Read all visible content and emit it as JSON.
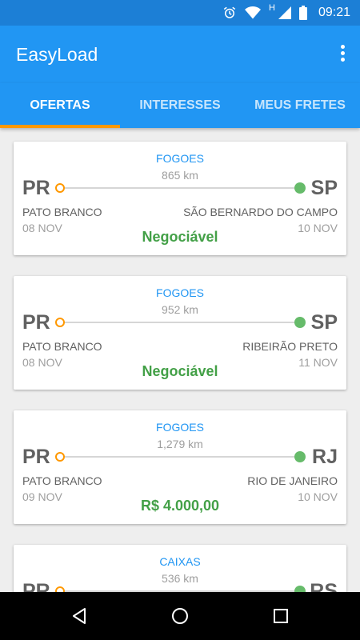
{
  "status_bar": {
    "time": "09:21",
    "network_letter": "H",
    "icons": [
      "alarm-icon",
      "wifi-icon",
      "signal-icon",
      "battery-icon"
    ]
  },
  "app": {
    "title": "EasyLoad",
    "menu_icon": "more-vert-icon"
  },
  "tabs": [
    {
      "label": "OFERTAS",
      "active": true
    },
    {
      "label": "INTERESSES",
      "active": false
    },
    {
      "label": "MEUS FRETES",
      "active": false
    }
  ],
  "offers": [
    {
      "category": "FOGOES",
      "distance": "865 km",
      "origin_state": "PR",
      "dest_state": "SP",
      "origin_city": "PATO BRANCO",
      "dest_city": "SÃO BERNARDO DO CAMPO",
      "origin_date": "08 NOV",
      "dest_date": "10 NOV",
      "price": "Negociável"
    },
    {
      "category": "FOGOES",
      "distance": "952 km",
      "origin_state": "PR",
      "dest_state": "SP",
      "origin_city": "PATO BRANCO",
      "dest_city": "RIBEIRÃO PRETO",
      "origin_date": "08 NOV",
      "dest_date": "11 NOV",
      "price": "Negociável"
    },
    {
      "category": "FOGOES",
      "distance": "1,279 km",
      "origin_state": "PR",
      "dest_state": "RJ",
      "origin_city": "PATO BRANCO",
      "dest_city": "RIO DE JANEIRO",
      "origin_date": "09 NOV",
      "dest_date": "10 NOV",
      "price": "R$ 4.000,00"
    },
    {
      "category": "CAIXAS",
      "distance": "536 km",
      "origin_state": "PR",
      "dest_state": "RS",
      "origin_city": "",
      "dest_city": "",
      "origin_date": "",
      "dest_date": "",
      "price": ""
    }
  ],
  "nav_bar": {
    "icons": [
      "back-icon",
      "home-icon",
      "recents-icon"
    ]
  },
  "colors": {
    "primary": "#2196f3",
    "primary_dark": "#1c7fd6",
    "accent": "#ff9800",
    "destination": "#66bb6a",
    "price": "#43a047"
  }
}
